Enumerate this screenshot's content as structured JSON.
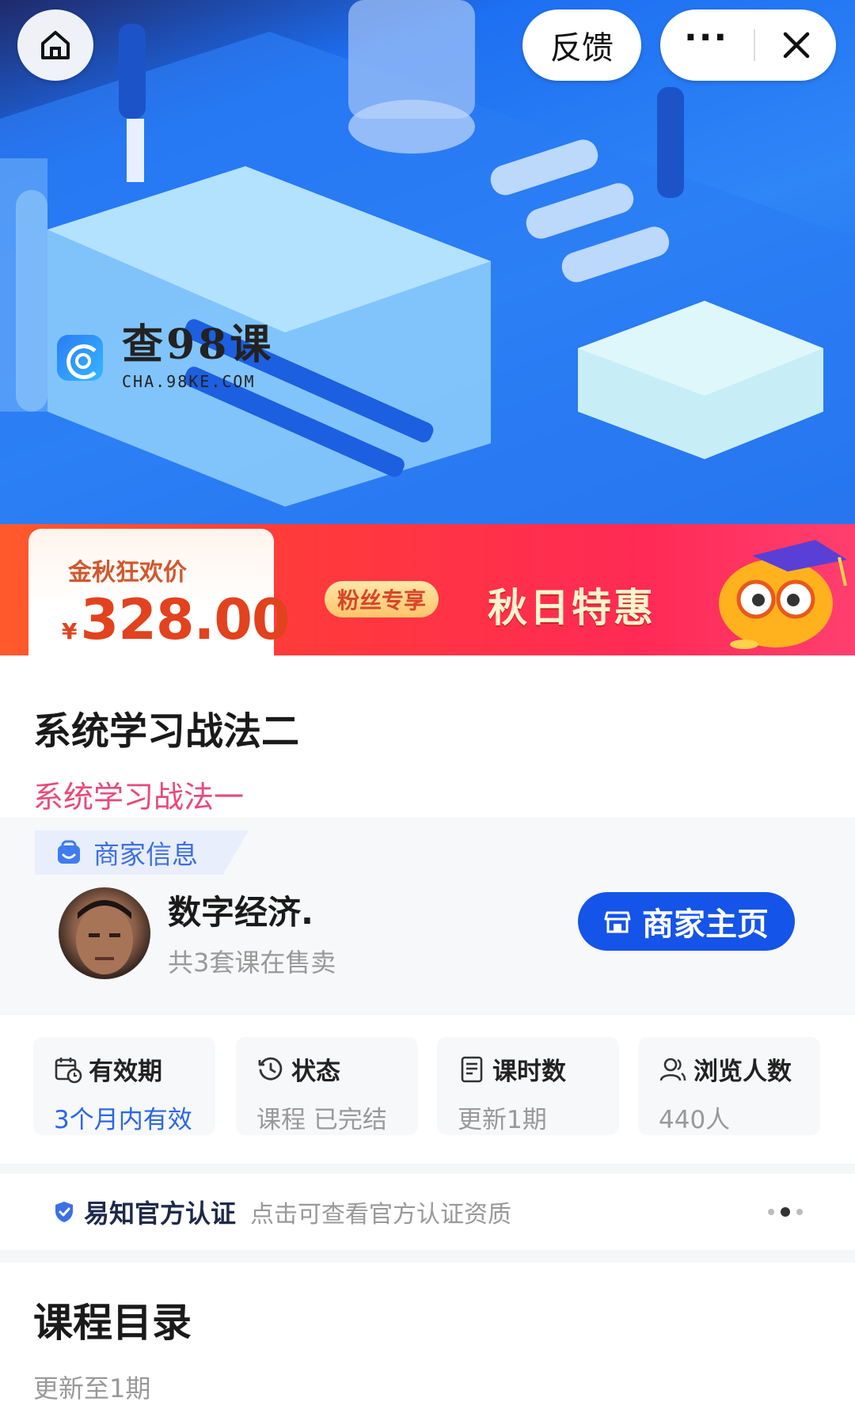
{
  "topbar": {
    "feedback_label": "反馈",
    "more_label": "···"
  },
  "hero": {
    "watermark_main": "查98课",
    "watermark_sub": "CHA.98KE.COM"
  },
  "promo": {
    "price_label": "金秋狂欢价",
    "currency": "¥",
    "price": "328.00",
    "fan_tag": "粉丝专享",
    "headline": "秋日特惠"
  },
  "course": {
    "title": "系统学习战法二",
    "subtitle": "系统学习战法一"
  },
  "merchant": {
    "section_label": "商家信息",
    "name": "数字经济.",
    "course_count": "共3套课在售卖",
    "home_button": "商家主页"
  },
  "stats": [
    {
      "label": "有效期",
      "value": "3个月内有效",
      "icon": "calendar-clock-icon"
    },
    {
      "label": "状态",
      "value": "课程  已完结",
      "icon": "history-icon"
    },
    {
      "label": "课时数",
      "value": "更新1期",
      "icon": "document-icon"
    },
    {
      "label": "浏览人数",
      "value": "440人",
      "icon": "users-icon"
    }
  ],
  "certification": {
    "title": "易知官方认证",
    "description": "点击可查看官方认证资质"
  },
  "catalog": {
    "title": "课程目录",
    "subtitle": "更新至1期"
  },
  "colors": {
    "brand_blue": "#1554e8",
    "price_red": "#e2421e",
    "subtitle_pink": "#e84a7a"
  }
}
